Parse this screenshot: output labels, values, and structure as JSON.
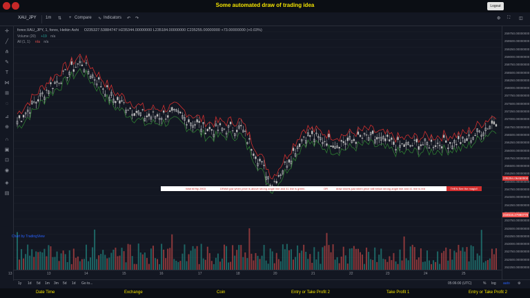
{
  "app": {
    "title": "Some automated draw of trading idea",
    "logout_label": "Logout"
  },
  "toolbar": {
    "symbol": "XAU_JPY",
    "interval": "1m",
    "compare_label": "Compare",
    "indicators_label": "Indicators"
  },
  "legend": {
    "main": "forex:XAU_JPY, 1, forex, Heikin Ashi",
    "ohlc": "O235327.53884747  H235344.00000000  L235184.00000000  C235255.00000000  +73.00000000 (+0.03%)",
    "volume_label": "Volume (20)",
    "volume_value": "+19",
    "volume_na": "n/a",
    "all_label": "All (1, 1)",
    "all_value": "n/a",
    "all_na": "n/a"
  },
  "price_axis": {
    "labels": [
      "259750.00000000",
      "259500.00000000",
      "259250.00000000",
      "259000.00000000",
      "258750.00000000",
      "258500.00000000",
      "258250.00000000",
      "258000.00000000",
      "257750.00000000",
      "257500.00000000",
      "257250.00000000",
      "257000.00000000",
      "256750.00000000",
      "256500.00000000",
      "256250.00000000",
      "256000.00000000",
      "255750.00000000",
      "255500.00000000",
      "255250.00000000",
      "255000.00000000",
      "254750.00000000",
      "254500.00000000",
      "254250.00000000",
      "254000.00000000",
      "253750.00000000",
      "253500.00000000",
      "253250.00000000",
      "253000.00000000",
      "252750.00000000",
      "252500.00000000",
      "252250.00000000"
    ],
    "last_price": "235294.06450000",
    "tag_price": "234516.27980770"
  },
  "date_axis": {
    "labels": [
      "13",
      "13",
      "14",
      "15",
      "16",
      "17",
      "18",
      "20",
      "21",
      "22",
      "23",
      "24",
      "25",
      "26",
      "27",
      "28"
    ]
  },
  "ranges": [
    "1y",
    "1d",
    "5d",
    "1m",
    "3m",
    "5d",
    "1d",
    "Go to..."
  ],
  "right_controls": {
    "time": "05:06:00 (UTC)",
    "percent": "%",
    "log": "log",
    "auto": "auto"
  },
  "watermark": "Chart by TradingView",
  "banner": {
    "segments": [
      "Wait till flip 2903",
      "DRAW just when   price is above strong angle line and 41 line is green.",
      "OR",
      "draw shorts just when price still below strong angle line and 41 line is red"
    ],
    "end_label": "THEN See the magic!!"
  },
  "footer_tabs": [
    "Date Time",
    "Exchange",
    "Coin",
    "Entry or Take Profit 2",
    "Take Profit 1",
    "Entry or Take Profit 2"
  ],
  "chart_data": {
    "type": "line",
    "x": [
      "13",
      "13",
      "14",
      "15",
      "16",
      "17",
      "18",
      "20",
      "21",
      "22",
      "23",
      "24",
      "25",
      "26",
      "27",
      "28"
    ],
    "series": [
      {
        "values": [
          256000,
          257500,
          258600,
          257000,
          256200,
          256300,
          255600,
          255700,
          253200,
          255400,
          255000,
          255300,
          254900,
          255000,
          255100,
          256000
        ]
      }
    ],
    "ylim": [
      252100,
      259900
    ]
  }
}
